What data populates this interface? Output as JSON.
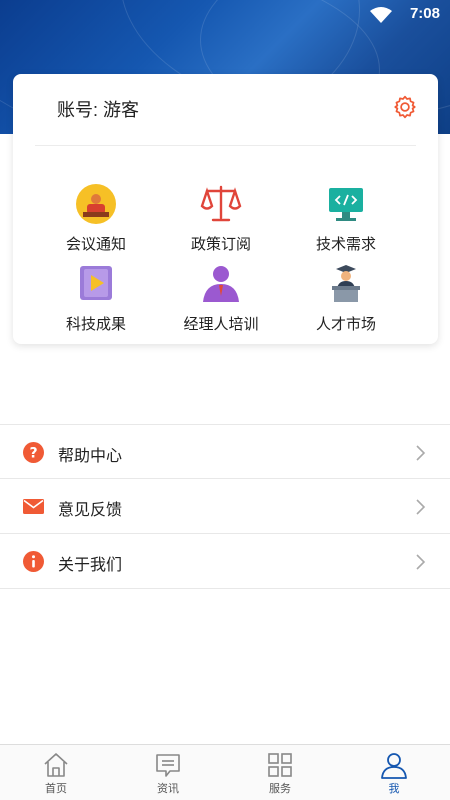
{
  "status": {
    "time": "7:08"
  },
  "account": {
    "label": "账号: 游客"
  },
  "grid": [
    {
      "label": "会议通知",
      "icon": "meeting-icon"
    },
    {
      "label": "政策订阅",
      "icon": "scales-icon"
    },
    {
      "label": "技术需求",
      "icon": "code-monitor-icon"
    },
    {
      "label": "科技成果",
      "icon": "play-video-icon"
    },
    {
      "label": "经理人培训",
      "icon": "manager-person-icon"
    },
    {
      "label": "人才市场",
      "icon": "graduate-podium-icon"
    }
  ],
  "menu": [
    {
      "label": "帮助中心",
      "icon": "help-icon"
    },
    {
      "label": "意见反馈",
      "icon": "mail-icon"
    },
    {
      "label": "关于我们",
      "icon": "info-icon"
    }
  ],
  "tabs": [
    {
      "label": "首页",
      "icon": "home-icon"
    },
    {
      "label": "资讯",
      "icon": "news-icon"
    },
    {
      "label": "服务",
      "icon": "grid-icon"
    },
    {
      "label": "我",
      "icon": "user-icon",
      "active": true
    }
  ],
  "colors": {
    "accent": "#1557b0",
    "menu_icon": "#f05a35"
  }
}
